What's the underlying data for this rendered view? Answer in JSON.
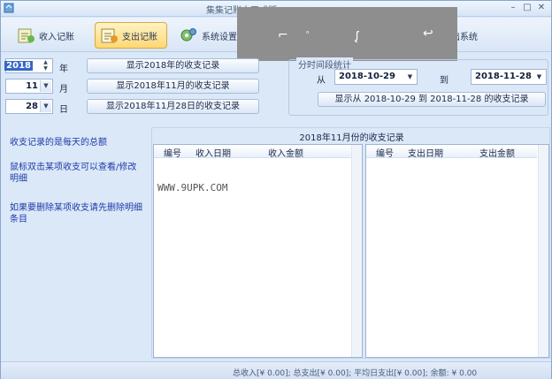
{
  "window": {
    "title": "集集记账本正式版"
  },
  "toolbar": {
    "items": [
      {
        "label": "收入记账",
        "icon": "income-icon"
      },
      {
        "label": "支出记账",
        "icon": "expense-icon",
        "active": true
      },
      {
        "label": "系统设置",
        "icon": "settings-icon"
      },
      {
        "label": "出系统",
        "icon": "exit-icon"
      }
    ]
  },
  "date_select": {
    "year": "2018",
    "year_unit": "年",
    "month": "11",
    "month_unit": "月",
    "day": "28",
    "day_unit": "日"
  },
  "buttons": {
    "show_year": "显示2018年的收支记录",
    "show_month": "显示2018年11月的收支记录",
    "show_day": "显示2018年11月28日的收支记录",
    "show_range": "显示从 2018-10-29 到 2018-11-28 的收支记录"
  },
  "range": {
    "group_title": "分时间段统计",
    "from_label": "从",
    "from_date": "2018-10-29",
    "to_label": "到",
    "to_date": "2018-11-28"
  },
  "hints": [
    "收支记录的是每天的总额",
    "鼠标双击某项收支可以查看/修改明细",
    "如果要删除某项收支请先删除明细条目"
  ],
  "panel": {
    "title": "2018年11月份的收支记录",
    "income_columns": [
      "编号",
      "收入日期",
      "收入金额"
    ],
    "expense_columns": [
      "编号",
      "支出日期",
      "支出金额"
    ],
    "watermark": "WWW.9UPK.COM"
  },
  "status": {
    "text": "总收入[¥ 0.00]; 总支出[¥ 0.00]; 平均日支出[¥ 0.00]; 余额: ¥ 0.00"
  },
  "colors": {
    "window_bg": "#dbe8f8",
    "active_tab": "#ffd874",
    "hint_text": "#1f3aa8"
  }
}
